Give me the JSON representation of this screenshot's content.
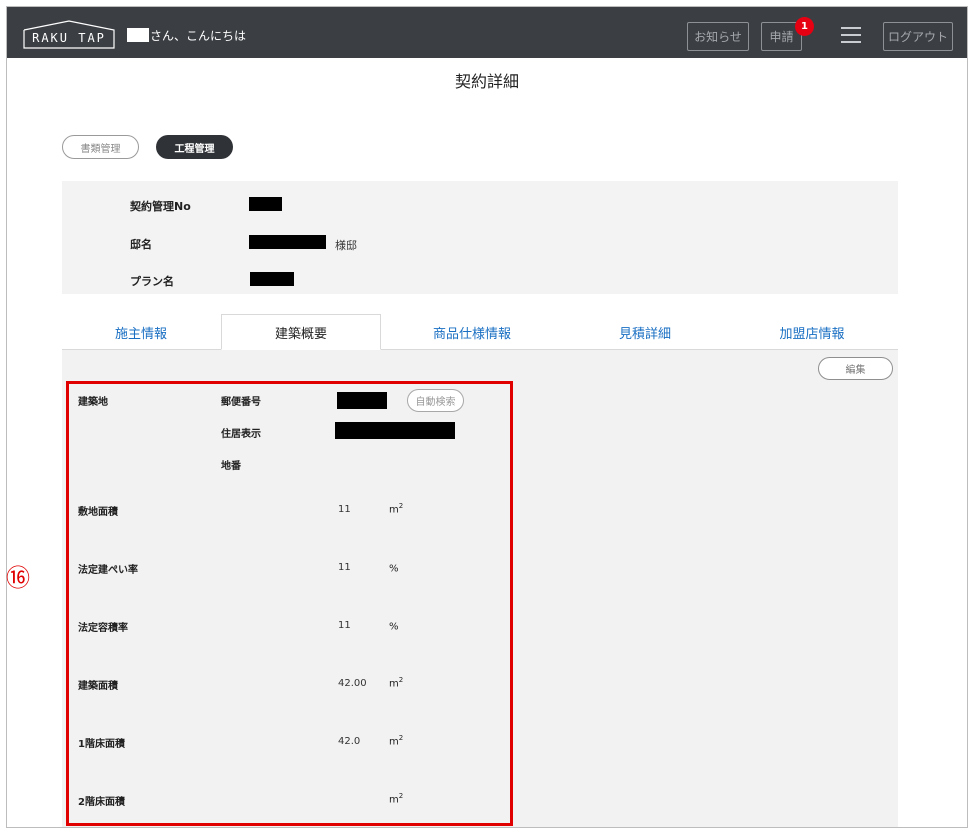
{
  "header": {
    "logo_text": "RAKU TAP",
    "greeting": "さん、こんにちは",
    "news_label": "お知らせ",
    "apply_label": "申請",
    "apply_badge": "1",
    "logout_label": "ログアウト"
  },
  "page": {
    "title": "契約詳細"
  },
  "buttons": {
    "docs": "書類管理",
    "process": "工程管理",
    "edit": "編集",
    "auto_search": "自動検索"
  },
  "contract": {
    "no_label": "契約管理No",
    "name_label": "邸名",
    "name_suffix": "様邸",
    "plan_label": "プラン名"
  },
  "tabs": [
    "施主情報",
    "建築概要",
    "商品仕様情報",
    "見積詳細",
    "加盟店情報"
  ],
  "active_tab": "建築概要",
  "overview": {
    "site_label": "建築地",
    "postal_label": "郵便番号",
    "address_label": "住居表示",
    "lot_label": "地番",
    "rows": [
      {
        "label": "敷地面積",
        "value": "11",
        "unit": "m",
        "sup": "2"
      },
      {
        "label": "法定建ぺい率",
        "value": "11",
        "unit": "%",
        "sup": ""
      },
      {
        "label": "法定容積率",
        "value": "11",
        "unit": "%",
        "sup": ""
      },
      {
        "label": "建築面積",
        "value": "42.00",
        "unit": "m",
        "sup": "2"
      },
      {
        "label": "1階床面積",
        "value": "42.0",
        "unit": "m",
        "sup": "2"
      },
      {
        "label": "2階床面積",
        "value": "",
        "unit": "m",
        "sup": "2"
      }
    ]
  },
  "annotation": {
    "marker": "⑯",
    "color": "#e00000"
  },
  "colors": {
    "header_bg": "#3b3e43",
    "tab_link": "#1a6fc3",
    "badge": "#e60012"
  }
}
